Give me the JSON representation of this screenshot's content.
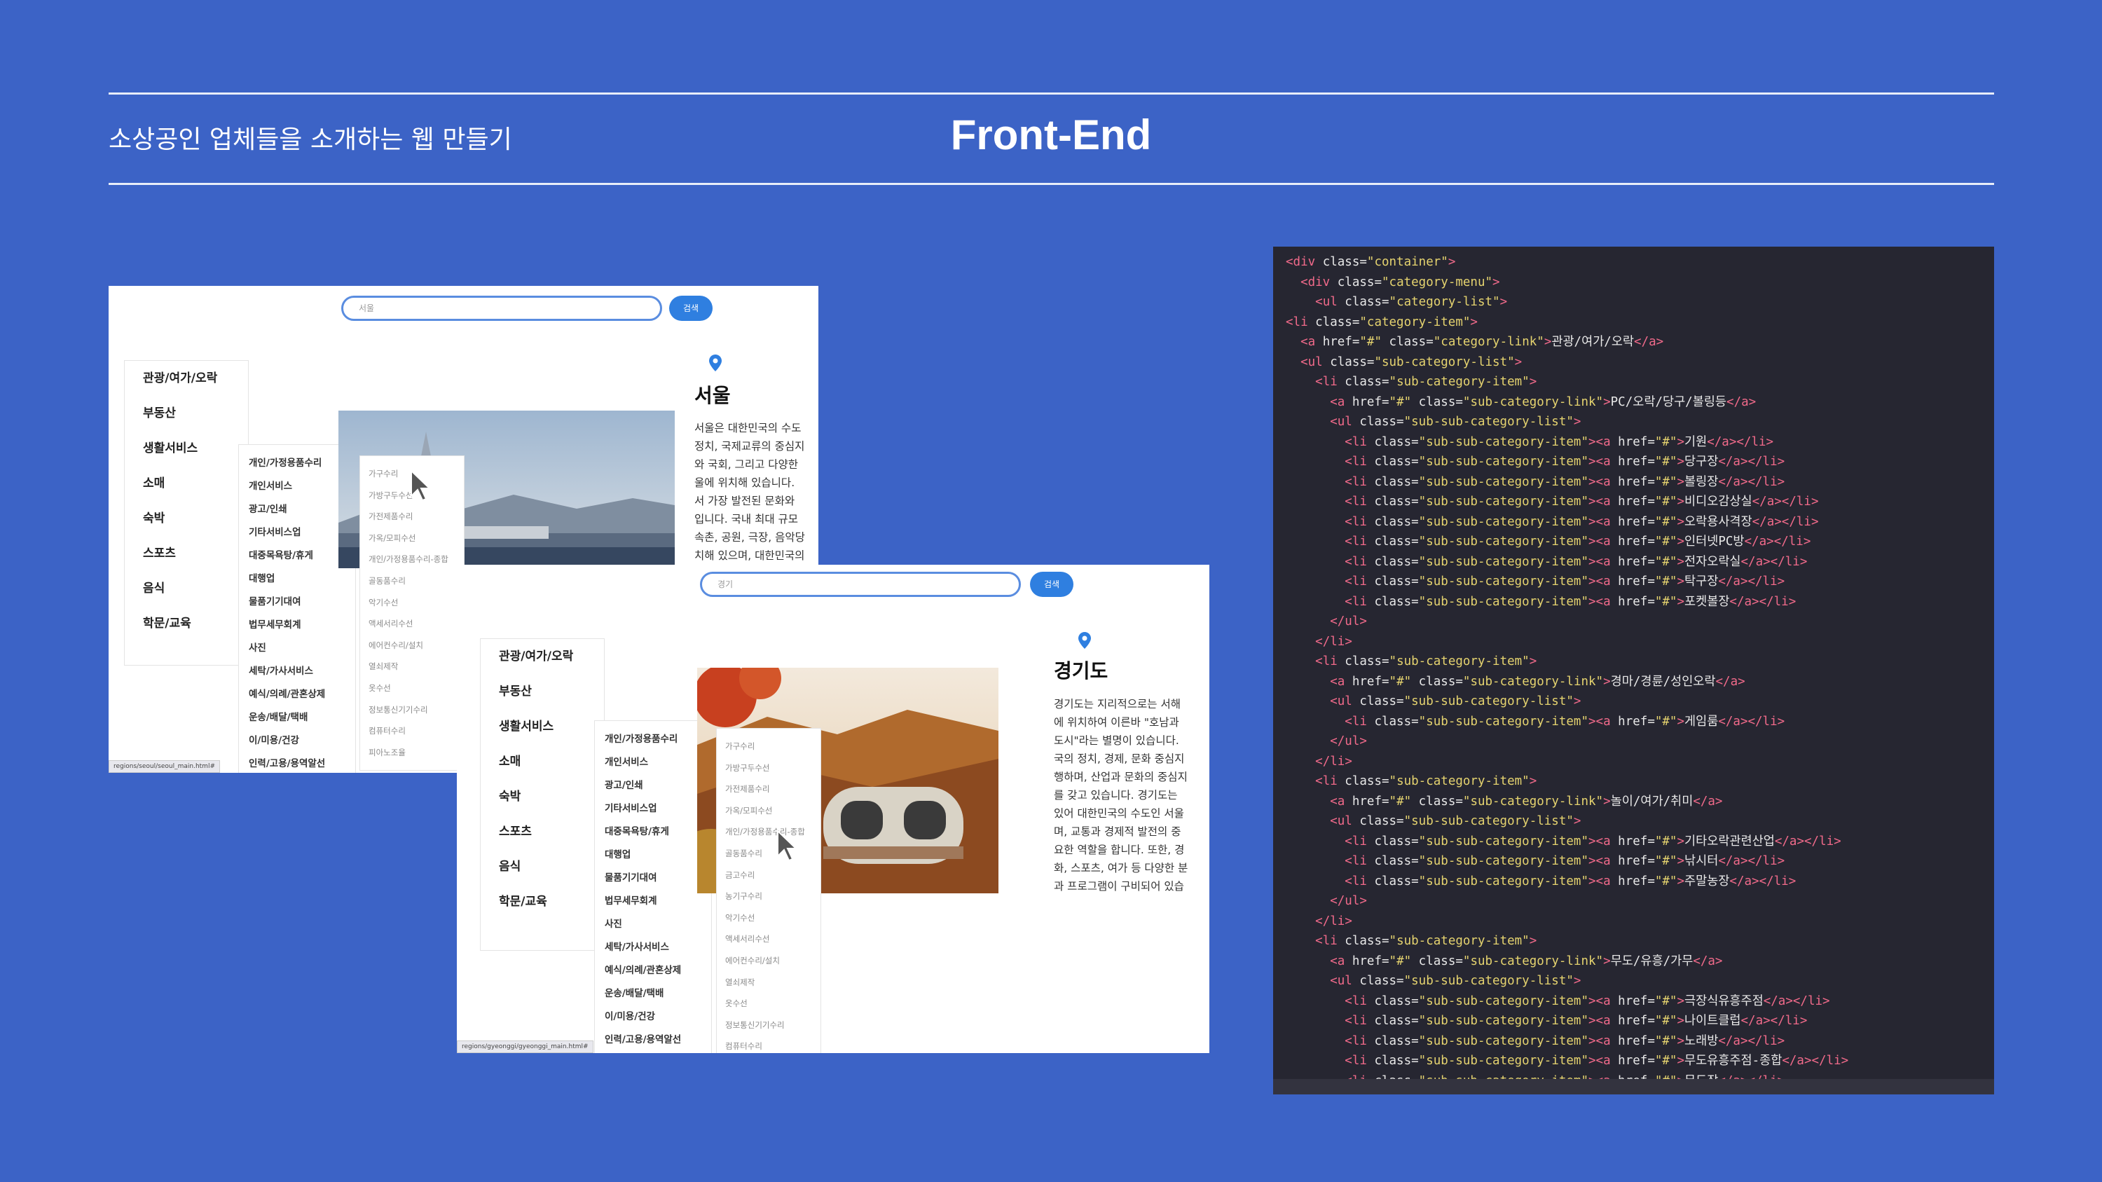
{
  "header": {
    "subtitle": "소상공인 업체들을 소개하는 웹 만들기",
    "title": "Front-End"
  },
  "seoul_page": {
    "search_placeholder": "서울",
    "search_button": "검색",
    "city_title": "서울",
    "categories": [
      "관광/여가/오락",
      "부동산",
      "생활서비스",
      "소매",
      "숙박",
      "스포츠",
      "음식",
      "학문/교육"
    ],
    "subcategories": [
      "개인/가정용품수리",
      "개인서비스",
      "광고/인쇄",
      "기타서비스업",
      "대중목욕탕/휴게",
      "대행업",
      "물품기기대여",
      "법무세무회계",
      "사진",
      "세탁/가사서비스",
      "예식/의례/관혼상제",
      "운송/배달/택배",
      "이/미용/건강",
      "인력/고용/용역알선"
    ],
    "subsubcategories": [
      "가구수리",
      "가방구두수선",
      "가전제품수리",
      "가옥/모피수선",
      "개인/가정용품수리-종합",
      "골동품수리",
      "악기수선",
      "액세서리수선",
      "에어컨수리/설치",
      "열쇠제작",
      "옷수선",
      "정보통신기기수리",
      "컴퓨터수리",
      "피아노조율"
    ],
    "description": [
      "서울은 대한민국의 수도",
      "정치, 국제교류의 중심지",
      "와 국회, 그리고 다양한",
      "울에 위치해 있습니다.",
      "서 가장 발전된 문화와",
      "입니다. 국내 최대 규모",
      "속촌, 공원, 극장, 음악당",
      "치해 있으며, 대한민국의"
    ],
    "status_url": "regions/seoul/seoul_main.html#"
  },
  "gyeonggi_page": {
    "search_placeholder": "경기",
    "search_button": "검색",
    "city_title": "경기도",
    "categories": [
      "관광/여가/오락",
      "부동산",
      "생활서비스",
      "소매",
      "숙박",
      "스포츠",
      "음식",
      "학문/교육"
    ],
    "subcategories": [
      "개인/가정용품수리",
      "개인서비스",
      "광고/인쇄",
      "기타서비스업",
      "대중목욕탕/휴게",
      "대행업",
      "물품기기대여",
      "법무세무회계",
      "사진",
      "세탁/가사서비스",
      "예식/의례/관혼상제",
      "운송/배달/택배",
      "이/미용/건강",
      "인력/고용/용역알선"
    ],
    "subsubcategories": [
      "가구수리",
      "가방구두수선",
      "가전제품수리",
      "가옥/모피수선",
      "개인/가정용품수리-종합",
      "골동품수리",
      "금고수리",
      "농기구수리",
      "악기수선",
      "액세서리수선",
      "에어컨수리/설치",
      "열쇠제작",
      "옷수선",
      "정보통신기기수리",
      "컴퓨터수리"
    ],
    "description": [
      "경기도는 지리적으로는 서해",
      "에 위치하여 이른바 \"호남과",
      "도시\"라는 별명이 있습니다.",
      "국의 정치, 경제, 문화 중심지",
      "행하며, 산업과 문화의 중심지",
      "를 갖고 있습니다. 경기도는",
      "있어 대한민국의 수도인 서울",
      "며, 교통과 경제적 발전의 중",
      "요한 역할을 합니다. 또한, 경",
      "화, 스포츠, 여가 등 다양한 분",
      "과 프로그램이 구비되어 있습"
    ],
    "status_url": "regions/gyeonggi/gyeonggi_main.html#"
  },
  "code_panel": {
    "lines": [
      "<div class=\"container\">",
      "  <div class=\"category-menu\">",
      "    <ul class=\"category-list\">",
      "<li class=\"category-item\">",
      "  <a href=\"#\" class=\"category-link\">관광/여가/오락</a>",
      "  <ul class=\"sub-category-list\">",
      "    <li class=\"sub-category-item\">",
      "      <a href=\"#\" class=\"sub-category-link\">PC/오락/당구/볼링등</a>",
      "      <ul class=\"sub-sub-category-list\">",
      "        <li class=\"sub-sub-category-item\"><a href=\"#\">기원</a></li>",
      "        <li class=\"sub-sub-category-item\"><a href=\"#\">당구장</a></li>",
      "        <li class=\"sub-sub-category-item\"><a href=\"#\">볼링장</a></li>",
      "        <li class=\"sub-sub-category-item\"><a href=\"#\">비디오감상실</a></li>",
      "        <li class=\"sub-sub-category-item\"><a href=\"#\">오락용사격장</a></li>",
      "        <li class=\"sub-sub-category-item\"><a href=\"#\">인터넷PC방</a></li>",
      "        <li class=\"sub-sub-category-item\"><a href=\"#\">전자오락실</a></li>",
      "        <li class=\"sub-sub-category-item\"><a href=\"#\">탁구장</a></li>",
      "        <li class=\"sub-sub-category-item\"><a href=\"#\">포켓볼장</a></li>",
      "      </ul>",
      "    </li>",
      "    <li class=\"sub-category-item\">",
      "      <a href=\"#\" class=\"sub-category-link\">경마/경륜/성인오락</a>",
      "      <ul class=\"sub-sub-category-list\">",
      "        <li class=\"sub-sub-category-item\"><a href=\"#\">게임룸</a></li>",
      "      </ul>",
      "    </li>",
      "    <li class=\"sub-category-item\">",
      "      <a href=\"#\" class=\"sub-category-link\">놀이/여가/취미</a>",
      "      <ul class=\"sub-sub-category-list\">",
      "        <li class=\"sub-sub-category-item\"><a href=\"#\">기타오락관련산업</a></li>",
      "        <li class=\"sub-sub-category-item\"><a href=\"#\">낚시터</a></li>",
      "        <li class=\"sub-sub-category-item\"><a href=\"#\">주말농장</a></li>",
      "      </ul>",
      "    </li>",
      "    <li class=\"sub-category-item\">",
      "      <a href=\"#\" class=\"sub-category-link\">무도/유흥/가무</a>",
      "      <ul class=\"sub-sub-category-list\">",
      "        <li class=\"sub-sub-category-item\"><a href=\"#\">극장식유흥주점</a></li>",
      "        <li class=\"sub-sub-category-item\"><a href=\"#\">나이트클럽</a></li>",
      "        <li class=\"sub-sub-category-item\"><a href=\"#\">노래방</a></li>",
      "        <li class=\"sub-sub-category-item\"><a href=\"#\">무도유흥주점-종합</a></li>",
      "        <li class=\"sub-sub-category-item\"><a href=\"#\">무도장</a></li>"
    ]
  }
}
